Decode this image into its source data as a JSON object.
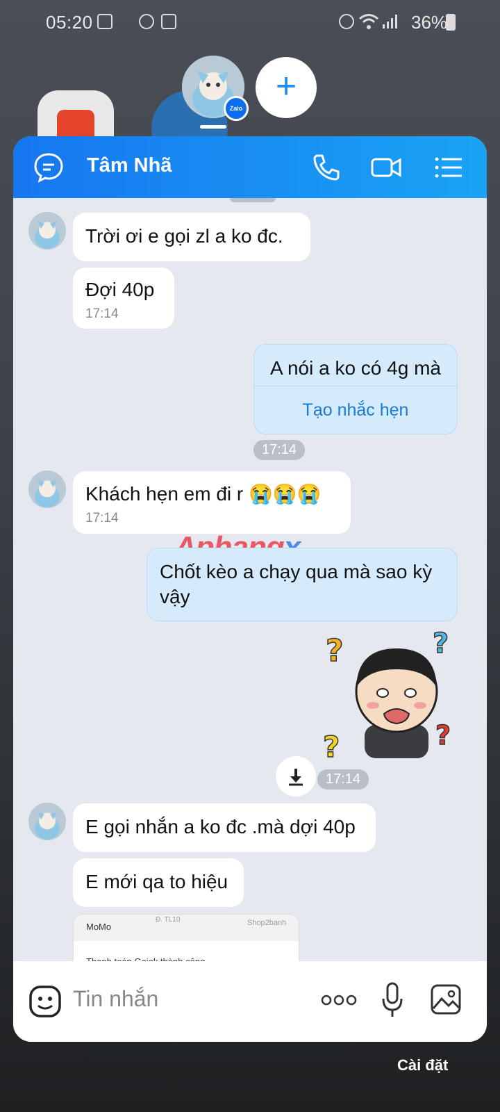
{
  "status_bar": {
    "time": "05:20",
    "battery": "36%"
  },
  "bubble_bar": {
    "add_label": "+",
    "badge": "Zalo"
  },
  "header": {
    "contact_name": "Tâm Nhã"
  },
  "messages": [
    {
      "from": "them",
      "text": "Trời ơi e gọi zl a ko đc."
    },
    {
      "from": "them",
      "text": "Đợi 40p",
      "time": "17:14"
    },
    {
      "from": "me",
      "text": "A nói a ko có 4g mà",
      "action": "Tạo nhắc hẹn",
      "time": "17:14"
    },
    {
      "from": "them",
      "text": "Khách hẹn em đi r 😭😭😭",
      "time": "17:14"
    },
    {
      "from": "me",
      "text": "Chốt kèo a chạy qua mà sao kỳ vậy"
    },
    {
      "from": "me",
      "type": "sticker",
      "time": "17:14"
    },
    {
      "from": "them",
      "text": "E gọi nhắn a ko đc .mà dợi 40p"
    },
    {
      "from": "them",
      "text": "E mới qa to hiệu"
    },
    {
      "from": "them",
      "type": "image",
      "preview_brand": "MoMo",
      "preview_road": "Đ. TL10",
      "preview_shop": "Shop2banh",
      "preview_text": "Thanh toán Gojek thành công"
    }
  ],
  "watermark": {
    "main": "Aphang",
    "x": "x"
  },
  "input": {
    "placeholder": "Tin nhắn"
  },
  "footer": {
    "settings_label": "Cài đặt"
  },
  "colors": {
    "header_start": "#1677f0",
    "header_end": "#1aa3f5",
    "my_bubble": "#d5ebfb",
    "chat_bg": "#e5e9ef"
  }
}
